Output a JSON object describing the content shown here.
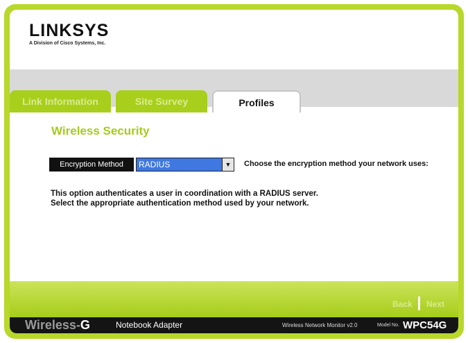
{
  "brand": {
    "logo_text": "LINKSYS",
    "logo_sub": "A Division of Cisco Systems, Inc."
  },
  "tabs": [
    {
      "label": "Link Information",
      "state": "inactive"
    },
    {
      "label": "Site Survey",
      "state": "inactive"
    },
    {
      "label": "Profiles",
      "state": "active"
    }
  ],
  "main": {
    "title": "Wireless Security",
    "encryption_label": "Encryption Method",
    "encryption_value": "RADIUS",
    "choose_text": "Choose the encryption method your network uses:",
    "description_line1": "This option authenticates a user in coordination with a RADIUS server.",
    "description_line2": "Select the appropriate authentication method used by your network."
  },
  "nav": {
    "back_label": "Back",
    "next_label": "Next"
  },
  "footer": {
    "product_wireless": "Wireless-",
    "product_g": "G",
    "product_type": "Notebook Adapter",
    "monitor": "Wireless Network Monitor v2.0",
    "model_label": "Model No.",
    "model": "WPC54G"
  },
  "colors": {
    "brand_green": "#a8cf1c",
    "title_green": "#a4cc1c",
    "select_blue": "#3f78e0"
  }
}
